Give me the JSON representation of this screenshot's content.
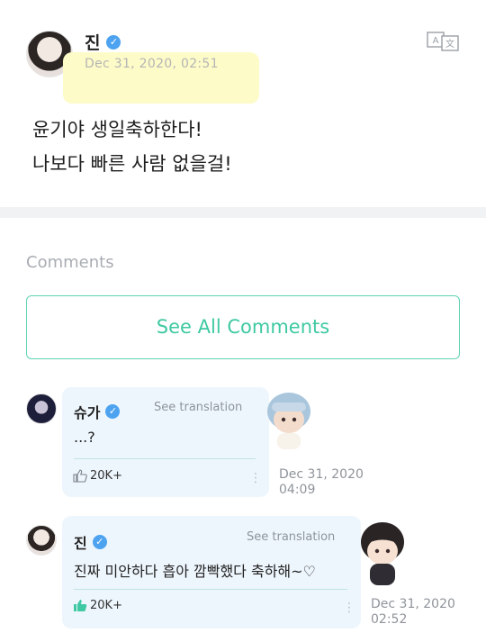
{
  "post": {
    "author": "진",
    "date": "Dec 31, 2020, 02:51",
    "lines": [
      "윤기야 생일축하한다!",
      "나보다 빠른 사람 없을걸!"
    ],
    "translate_icon": "translate-icon"
  },
  "comments_section": {
    "label": "Comments",
    "see_all": "See All Comments",
    "items": [
      {
        "author": "슈가",
        "see_translation": "See translation",
        "text": "...?",
        "likes": "20K+",
        "date_line1": "Dec 31, 2020",
        "date_line2": "04:09"
      },
      {
        "author": "진",
        "see_translation": "See translation",
        "text": "진짜 미안하다 흡아 깜빡했다 축하해~♡",
        "likes": "20K+",
        "date_line1": "Dec 31, 2020",
        "date_line2": "02:52"
      }
    ]
  },
  "colors": {
    "accent": "#3fc9a2",
    "verified": "#4da3f0",
    "bubble": "#eef6fd",
    "highlight": "#fdfbc8"
  }
}
